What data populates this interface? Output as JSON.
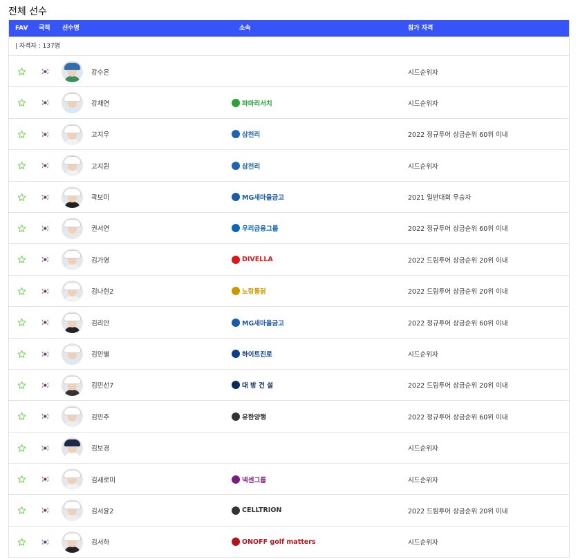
{
  "page": {
    "title": "전체 선수"
  },
  "table": {
    "headers": {
      "fav": "FAV",
      "nation": "국적",
      "player": "선수명",
      "sponsor": "소속",
      "qualification": "참가 자격"
    },
    "count_label": "| 자격자 : 137명",
    "colors": {
      "header_bg": "#3754fb",
      "star": "#6fd24a",
      "border": "#e3e3e3"
    },
    "rows": [
      {
        "name": "강수은",
        "sponsor": "",
        "sponsor_color": "#000000",
        "qualification": "시드순위자",
        "hat": "#2f6fb0",
        "shirt": "#3b8f5a"
      },
      {
        "name": "강채연",
        "sponsor": "파마리서치",
        "sponsor_color": "#2aa236",
        "qualification": "시드순위자",
        "hat": "#ffffff",
        "shirt": "#d8e8f6"
      },
      {
        "name": "고지우",
        "sponsor": "삼천리",
        "sponsor_color": "#1f64b0",
        "qualification": "2022 정규투어 상금순위 60위 이내",
        "hat": "#ffffff",
        "shirt": "#f2f2f2"
      },
      {
        "name": "고지원",
        "sponsor": "삼천리",
        "sponsor_color": "#1f64b0",
        "qualification": "시드순위자",
        "hat": "#ffffff",
        "shirt": "#f2f2f2"
      },
      {
        "name": "곽보미",
        "sponsor": "MG새마을금고",
        "sponsor_color": "#1a5aa6",
        "qualification": "2021 일반대회 우승자",
        "hat": "#ffffff",
        "shirt": "#222222"
      },
      {
        "name": "권서연",
        "sponsor": "우리금융그룹",
        "sponsor_color": "#0e66b3",
        "qualification": "2022 정규투어 상금순위 60위 이내",
        "hat": "#ffffff",
        "shirt": "#e8e8e8"
      },
      {
        "name": "김가영",
        "sponsor": "DIVELLA",
        "sponsor_color": "#d8181c",
        "qualification": "2022 드림투어 상금순위 20위 이내",
        "hat": "#ffffff",
        "shirt": "#eeeeee"
      },
      {
        "name": "김나현2",
        "sponsor": "노랑통닭",
        "sponsor_color": "#c89a00",
        "qualification": "2022 드림투어 상금순위 20위 이내",
        "hat": "#ffffff",
        "shirt": "#f2f2f2"
      },
      {
        "name": "김리안",
        "sponsor": "MG새마을금고",
        "sponsor_color": "#1a5aa6",
        "qualification": "2022 정규투어 상금순위 60위 이내",
        "hat": "#ffffff",
        "shirt": "#222222"
      },
      {
        "name": "김민별",
        "sponsor": "하이트진로",
        "sponsor_color": "#0a3d8c",
        "qualification": "시드순위자",
        "hat": "#ffffff",
        "shirt": "#dfe8f2"
      },
      {
        "name": "김민선7",
        "sponsor": "대 방 건 설",
        "sponsor_color": "#0b2a5a",
        "qualification": "2022 드림투어 상금순위 20위 이내",
        "hat": "#ffffff",
        "shirt": "#333333"
      },
      {
        "name": "김민주",
        "sponsor": "유한양행",
        "sponsor_color": "#333333",
        "qualification": "2022 정규투어 상금순위 60위 이내",
        "hat": "#ffffff",
        "shirt": "#eeeeee"
      },
      {
        "name": "김보경",
        "sponsor": "",
        "sponsor_color": "#000000",
        "qualification": "시드순위자",
        "hat": "#1d2a4a",
        "shirt": "#ffffff"
      },
      {
        "name": "김새로미",
        "sponsor": "넥센그룹",
        "sponsor_color": "#7b1d7f",
        "qualification": "시드순위자",
        "hat": "#ffffff",
        "shirt": "#f2f2f2"
      },
      {
        "name": "김서윤2",
        "sponsor": "CELLTRION",
        "sponsor_color": "#333333",
        "qualification": "2022 드림투어 상금순위 20위 이내",
        "hat": "#ffffff",
        "shirt": "#eeeeee"
      },
      {
        "name": "김서하",
        "sponsor": "ONOFF golf matters",
        "sponsor_color": "#b3141c",
        "qualification": "시드순위자",
        "hat": "#ffffff",
        "shirt": "#222222"
      }
    ]
  }
}
